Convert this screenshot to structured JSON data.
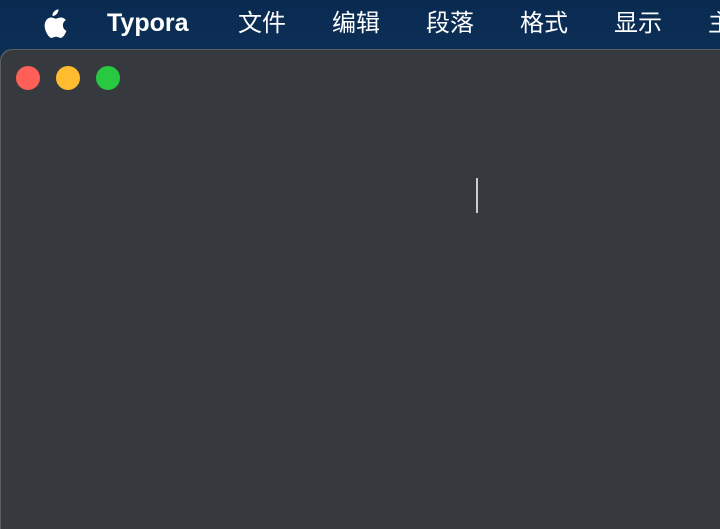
{
  "menubar": {
    "apple_icon": "apple-logo-icon",
    "app_name": "Typora",
    "items": [
      {
        "label": "文件"
      },
      {
        "label": "编辑"
      },
      {
        "label": "段落"
      },
      {
        "label": "格式"
      },
      {
        "label": "显示"
      },
      {
        "label": "主"
      }
    ]
  },
  "window": {
    "traffic_lights": {
      "close_color": "#ff5f57",
      "minimize_color": "#febc2e",
      "zoom_color": "#28c840"
    },
    "editor": {
      "background": "#363a3f",
      "content": ""
    }
  }
}
